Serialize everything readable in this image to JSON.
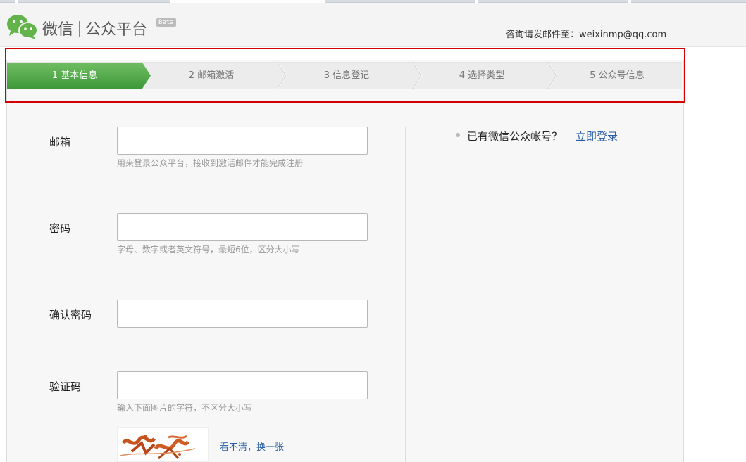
{
  "header": {
    "logo_name": "微信",
    "logo_product": "公众平台",
    "beta_badge": "Beta",
    "contact_text": "咨询请发邮件至：weixinmp@qq.com"
  },
  "steps": [
    {
      "label": "1 基本信息",
      "active": true
    },
    {
      "label": "2 邮箱激活",
      "active": false
    },
    {
      "label": "3 信息登记",
      "active": false
    },
    {
      "label": "4 选择类型",
      "active": false
    },
    {
      "label": "5 公众号信息",
      "active": false
    }
  ],
  "form": {
    "email": {
      "label": "邮箱",
      "value": "",
      "hint": "用来登录公众平台，接收到激活邮件才能完成注册"
    },
    "password": {
      "label": "密码",
      "value": "",
      "hint": "字母、数字或者英文符号，最短6位，区分大小写"
    },
    "confirm_password": {
      "label": "确认密码",
      "value": ""
    },
    "captcha": {
      "label": "验证码",
      "value": "",
      "hint": "输入下面图片的字符，不区分大小写",
      "refresh_link": "看不清，换一张"
    }
  },
  "sidebar": {
    "prompt": "已有微信公众帐号？",
    "login_link": "立即登录"
  },
  "colors": {
    "step_active": "#4aa843",
    "link": "#2a5ea5",
    "highlight_box": "#d40000"
  }
}
